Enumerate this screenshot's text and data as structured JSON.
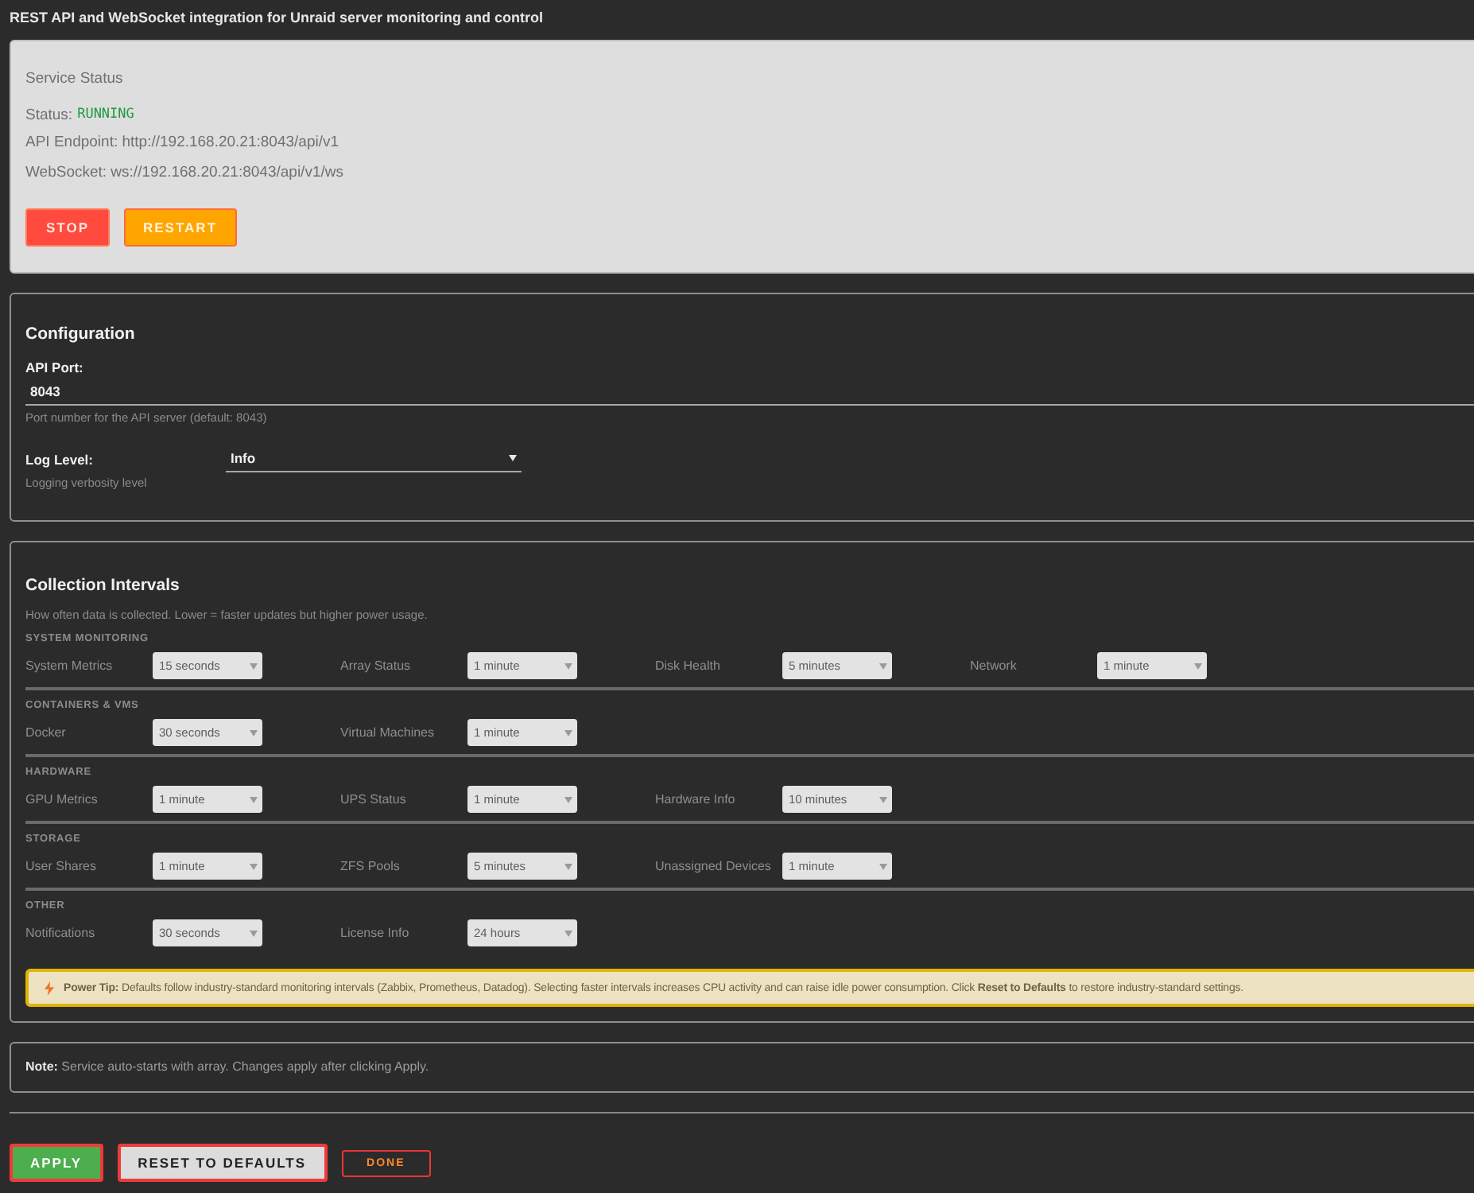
{
  "page": {
    "subtitle": "REST API and WebSocket integration for Unraid server monitoring and control"
  },
  "status_panel": {
    "title": "Service Status",
    "status": {
      "label": "Status:",
      "value": "RUNNING",
      "running": true
    },
    "lines": [
      "API Endpoint: http://192.168.20.21:8043/api/v1",
      "WebSocket: ws://192.168.20.21:8043/api/v1/ws"
    ],
    "buttons": [
      {
        "label": "STOP",
        "kind": "stop"
      },
      {
        "label": "RESTART",
        "kind": "restart"
      }
    ]
  },
  "configuration": {
    "title": "Configuration",
    "fields": [
      {
        "kind": "input",
        "label": "API Port:",
        "value": "8043",
        "hint": "Port number for the API server (default: 8043)"
      },
      {
        "kind": "select",
        "label": "Log Level:",
        "value": "Info",
        "hint": "Logging verbosity level"
      }
    ]
  },
  "collection_intervals": {
    "title": "Collection Intervals",
    "description": "How often data is collected. Lower = faster updates but higher power usage.",
    "groups": [
      {
        "heading": "SYSTEM MONITORING",
        "items": [
          {
            "label": "System Metrics",
            "value": "15 seconds"
          },
          {
            "label": "Array Status",
            "value": "1 minute"
          },
          {
            "label": "Disk Health",
            "value": "5 minutes"
          },
          {
            "label": "Network",
            "value": "1 minute"
          }
        ]
      },
      {
        "heading": "CONTAINERS & VMS",
        "items": [
          {
            "label": "Docker",
            "value": "30 seconds"
          },
          {
            "label": "Virtual Machines",
            "value": "1 minute"
          }
        ]
      },
      {
        "heading": "HARDWARE",
        "items": [
          {
            "label": "GPU Metrics",
            "value": "1 minute"
          },
          {
            "label": "UPS Status",
            "value": "1 minute"
          },
          {
            "label": "Hardware Info",
            "value": "10 minutes"
          }
        ]
      },
      {
        "heading": "STORAGE",
        "items": [
          {
            "label": "User Shares",
            "value": "1 minute"
          },
          {
            "label": "ZFS Pools",
            "value": "5 minutes"
          },
          {
            "label": "Unassigned Devices",
            "value": "1 minute"
          }
        ]
      },
      {
        "heading": "OTHER",
        "items": [
          {
            "label": "Notifications",
            "value": "30 seconds"
          },
          {
            "label": "License Info",
            "value": "24 hours"
          }
        ]
      }
    ],
    "tip": "**Power Tip:** Defaults follow industry-standard monitoring intervals (Zabbix, Prometheus, Datadog). Selecting faster intervals increases CPU activity and can raise idle power consumption. Click **Reset to Defaults** to restore industry-standard settings."
  },
  "note": "**Note:** Service auto-starts with array. Changes apply after clicking Apply.",
  "actions": [
    {
      "label": "APPLY",
      "kind": "apply"
    },
    {
      "label": "RESET TO DEFAULTS",
      "kind": "reset"
    },
    {
      "label": "DONE",
      "kind": "done"
    }
  ]
}
